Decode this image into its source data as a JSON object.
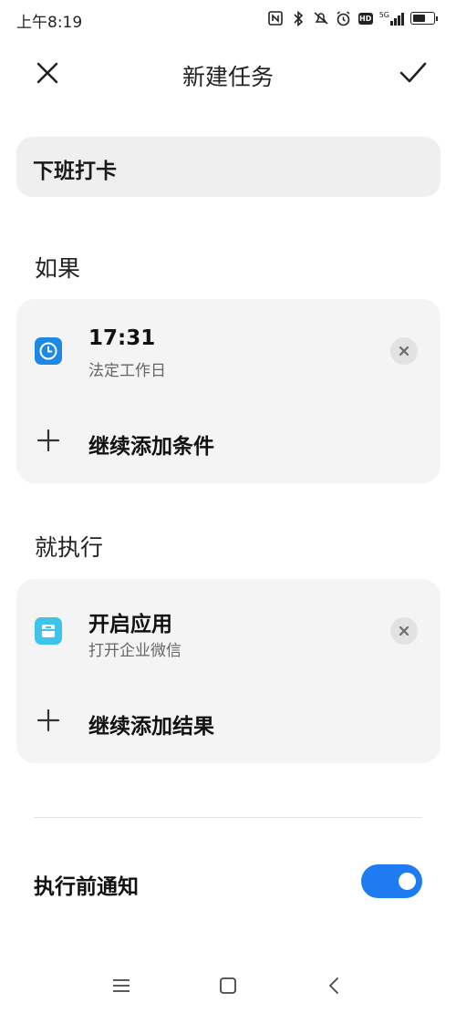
{
  "status": {
    "time": "上午8:19",
    "icons": [
      "nfc-icon",
      "bluetooth-icon",
      "mute-icon",
      "alarm-icon",
      "hd-icon",
      "signal-5g-icon",
      "battery-icon"
    ],
    "hd": "HD",
    "network": "5G"
  },
  "header": {
    "title": "新建任务",
    "close_icon": "close-icon",
    "confirm_icon": "check-icon"
  },
  "task": {
    "name": "下班打卡"
  },
  "if_section": {
    "title": "如果",
    "condition": {
      "title": "17:31",
      "subtitle": "法定工作日",
      "icon": "clock-icon",
      "icon_color": "#1e88e5"
    },
    "add_label": "继续添加条件"
  },
  "then_section": {
    "title": "就执行",
    "action": {
      "title": "开启应用",
      "subtitle": "打开企业微信",
      "icon": "app-icon",
      "icon_color": "#3fc3e8"
    },
    "add_label": "继续添加结果"
  },
  "notify": {
    "label": "执行前通知",
    "enabled": true,
    "toggle_color": "#1e7bf0"
  },
  "navbar": {
    "icons": [
      "menu-icon",
      "home-icon",
      "back-icon"
    ]
  }
}
